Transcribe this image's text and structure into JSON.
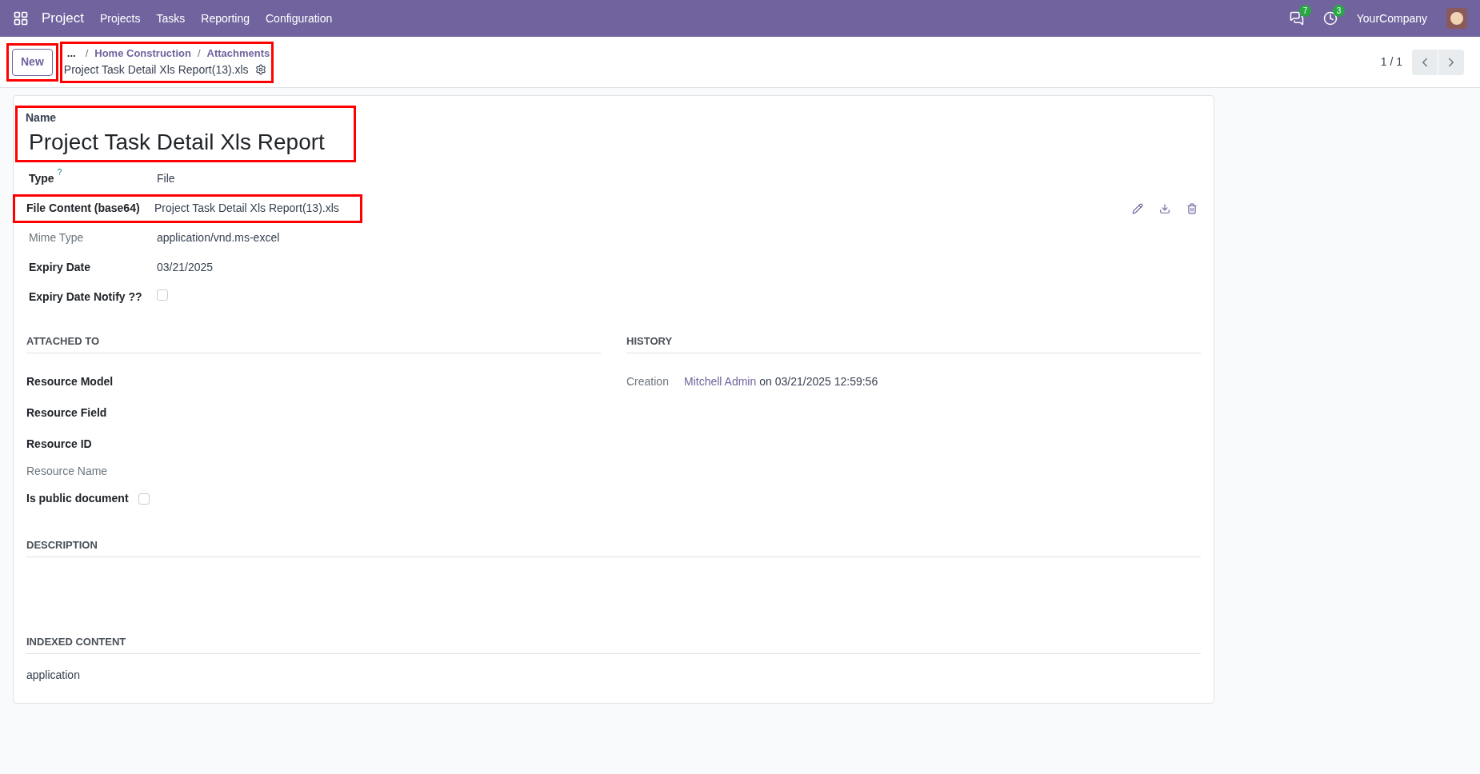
{
  "navbar": {
    "app": "Project",
    "menu": [
      "Projects",
      "Tasks",
      "Reporting",
      "Configuration"
    ],
    "messages_badge": "7",
    "activities_badge": "3",
    "company": "YourCompany"
  },
  "control_panel": {
    "new_button": "New",
    "breadcrumbs": [
      {
        "label": "..."
      },
      {
        "separator": "/",
        "label": "Home Construction"
      },
      {
        "separator": "/",
        "label": "Attachments"
      }
    ],
    "record_title": "Project Task Detail Xls Report(13).xls",
    "pager": "1 / 1"
  },
  "form": {
    "name_label": "Name",
    "name_value": "Project Task Detail Xls Report",
    "fields": [
      {
        "kind": "text",
        "label": "Type",
        "help": "?",
        "value": "File",
        "muted": false,
        "highlighted": false
      },
      {
        "kind": "binary",
        "label": "File Content (base64)",
        "value": "Project Task Detail Xls Report(13).xls",
        "muted": false,
        "highlighted": true
      },
      {
        "kind": "text",
        "label": "Mime Type",
        "value": "application/vnd.ms-excel",
        "muted": true,
        "highlighted": false
      },
      {
        "kind": "text",
        "label": "Expiry Date",
        "value": "03/21/2025",
        "muted": false,
        "highlighted": false
      },
      {
        "kind": "checkbox",
        "label": "Expiry Date Notify ??",
        "checked": false,
        "muted": false,
        "highlighted": false
      }
    ],
    "attached_to": {
      "title": "ATTACHED TO",
      "fields": [
        {
          "kind": "text",
          "label": "Resource Model",
          "muted": false
        },
        {
          "kind": "text",
          "label": "Resource Field",
          "muted": false
        },
        {
          "kind": "text",
          "label": "Resource ID",
          "muted": false
        },
        {
          "kind": "text",
          "label": "Resource Name",
          "muted": true
        },
        {
          "kind": "checkbox",
          "label": "Is public document",
          "checked": false,
          "muted": false
        }
      ]
    },
    "history": {
      "title": "HISTORY",
      "label": "Creation",
      "user": "Mitchell Admin",
      "text": "on 03/21/2025 12:59:56"
    },
    "description": {
      "title": "DESCRIPTION"
    },
    "indexed_content": {
      "title": "INDEXED CONTENT",
      "value": "application"
    }
  }
}
